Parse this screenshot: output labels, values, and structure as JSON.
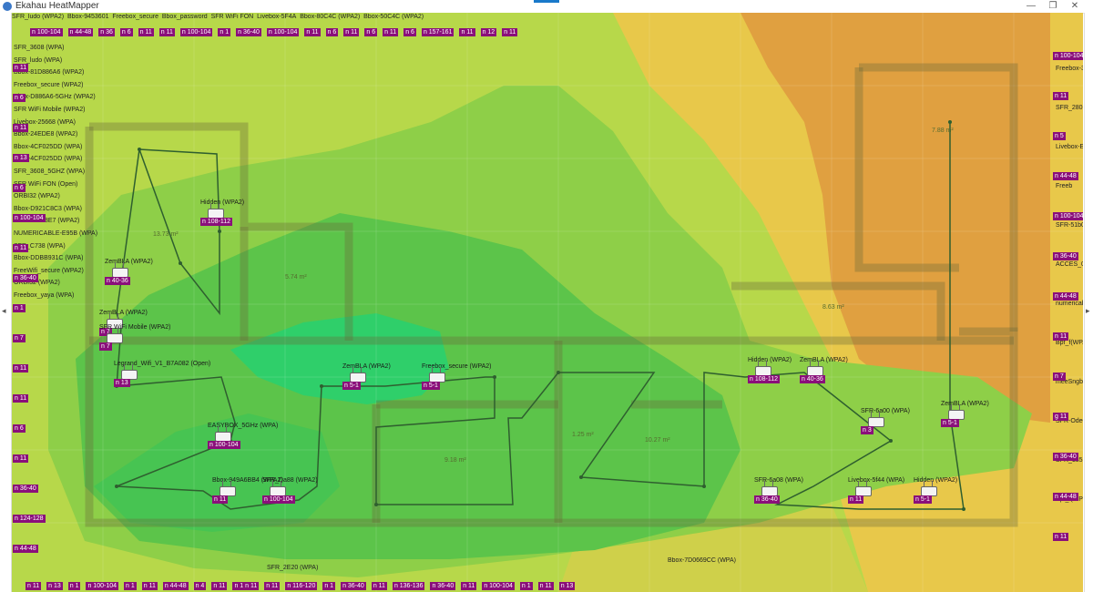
{
  "window": {
    "title": "Ekahau HeatMapper",
    "minimize_glyph": "—",
    "maximize_glyph": "❐",
    "close_glyph": "✕"
  },
  "colors": {
    "accent": "#1979ca",
    "channel_tag": "#8a0f7a",
    "heat_strong": "#2fcf6a",
    "heat_good": "#5cc44a",
    "heat_mid": "#a9d34a",
    "heat_weak": "#e8c84a",
    "heat_low": "#e0a040"
  },
  "left_strip_arrow": "◂",
  "right_strip_arrow": "▸",
  "room_labels": [
    "13.73 m²",
    "5.74 m²",
    "7.88 m²",
    "8.63 m²",
    "9.18 m²",
    "10.27 m²",
    "1.25 m²"
  ],
  "access_points": [
    {
      "ssid": "Hidden (WPA2)",
      "channel": "n 108-112"
    },
    {
      "ssid": "ZemBLA (WPA2)",
      "channel": "n 40-36"
    },
    {
      "ssid": "ZemBLA (WPA2)",
      "channel": "n 7"
    },
    {
      "ssid": "SFR WiFi Mobile (WPA2)",
      "channel": "n 7"
    },
    {
      "ssid": "Legrand_Wifi_V1_B7A082 (Open)",
      "channel": "n 13"
    },
    {
      "ssid": "ZemBLA (WPA2)",
      "channel": "n 5-1"
    },
    {
      "ssid": "Freebox_secure (WPA2)",
      "channel": "n 5-1"
    },
    {
      "ssid": "EASYBOX_5GHz (WPA)",
      "channel": "n 100-104"
    },
    {
      "ssid": "Bbox-949A6BB4 (WPA2)",
      "channel": "n 11"
    },
    {
      "ssid": "SFR_Da88 (WPA2)",
      "channel": "n 100-104"
    },
    {
      "ssid": "Hidden (WPA2)",
      "channel": "n 108-112"
    },
    {
      "ssid": "ZemBLA (WPA2)",
      "channel": "n 40-36"
    },
    {
      "ssid": "SFR-6a00 (WPA)",
      "channel": "n 3"
    },
    {
      "ssid": "ZemBLA (WPA2)",
      "channel": "n 5-1"
    },
    {
      "ssid": "SFR-6a08 (WPA)",
      "channel": "n 36-40"
    },
    {
      "ssid": "Livebox-5f44 (WPA)",
      "channel": "n 11"
    },
    {
      "ssid": "Hidden (WPA2)",
      "channel": "n 5-1"
    }
  ],
  "left_edge_ssids": [
    "SFR_3608 (WPA)",
    "SFR_ludo (WPA)",
    "Bbox-81D886A6 (WPA2)",
    "Freebox_secure (WPA2)",
    "Bbox-D886A6-5GHz (WPA2)",
    "SFR WiFi Mobile (WPA2)",
    "Livebox-25668 (WPA)",
    "Bbox-24EDE8 (WPA2)",
    "Bbox-4CF025DD (WPA)",
    "Bbox-4CF025DD (WPA)",
    "SFR_3608_5GHZ (WPA)",
    "SFR WiFi FON (Open)",
    "ORBI32 (WPA2)",
    "Bbox-D921C8C3 (WPA)",
    "HUAWEI-68E7 (WPA2)",
    "NUMERICABLE-E95B (WPA)",
    "SFR_C738 (WPA)",
    "Bbox-DDBB931C (WPA)",
    "FreeWifi_secure (WPA2)",
    "ORBI32 (WPA2)",
    "Freebox_yaya (WPA)"
  ],
  "left_edge_tags": [
    "n 11",
    "n 6",
    "n 11",
    "n 13",
    "n 6",
    "n 100-104",
    "n 11",
    "n 36-40",
    "n 1",
    "n 7",
    "n 11",
    "n 11",
    "n 6",
    "n 11",
    "n 36-40",
    "n 124-128",
    "n 44-48"
  ],
  "right_edge_ssids": [
    "Freebox-3C",
    "SFR_2808",
    "Livebox-E4",
    "Freeb",
    "SFR-51b0",
    "ACCES_07",
    "numericab",
    "Bpf_f(WPA)",
    "meeSngbc",
    "SFR-Ode0",
    "SFR_1858",
    "Bpf_f(WP"
  ],
  "right_edge_tags": [
    "n 100-104",
    "n 11",
    "n 5",
    "n 44-48",
    "n 100-104",
    "n 36-40",
    "n 44-48",
    "n 11",
    "n 7",
    "g 11",
    "n 36-40",
    "n 44-48",
    "n 11"
  ],
  "top_edge_labels": [
    "SFR_ludo (WPA2)",
    "Bbox-9453601",
    "Freebox_secure",
    "Bbox_password",
    "SFR WiFi FON",
    "Livebox-5F4A",
    "Bbox-80C4C (WPA2)",
    "Bbox-50C4C (WPA2)"
  ],
  "top_edge_tags": [
    "n 100-104",
    "n 44-48",
    "n 36",
    "n 6",
    "n 11",
    "n 11",
    "n 100-104",
    "n 1",
    "n 36-40",
    "n 100-104",
    "n 11",
    "n 6",
    "n 11",
    "n 6",
    "n 11",
    "n 6",
    "n 157-161",
    "n 11",
    "n 12",
    "n 11"
  ],
  "bottom_edge_labels": [
    "Bbox-7D0669CC (WPA)",
    "SFR_2E20 (WPA)"
  ],
  "bottom_edge_tags": [
    "n 11",
    "n 13",
    "n 1",
    "n 100-104",
    "n 1",
    "n 11",
    "n 44-48",
    "n 4",
    "n 11",
    "n 1 n 11",
    "n 11",
    "n 116-120",
    "n 1",
    "n 36-40",
    "n 11",
    "n 136-136",
    "n 36-40",
    "n 11",
    "n 100-104",
    "n 1",
    "n 11",
    "n 13"
  ]
}
